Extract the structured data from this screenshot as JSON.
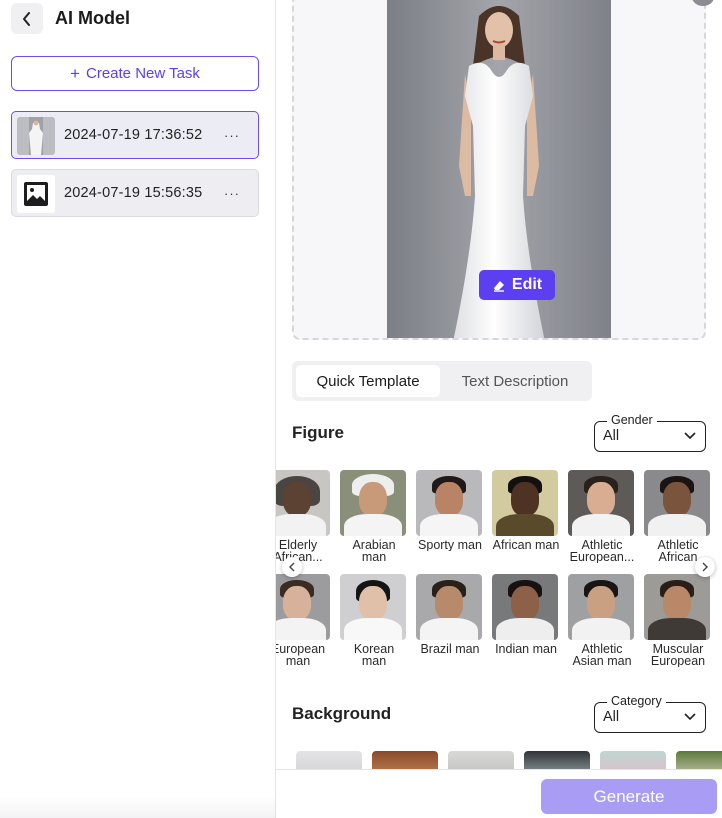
{
  "header": {
    "title": "AI Model"
  },
  "sidebar": {
    "create_label": "Create New Task",
    "tasks": [
      {
        "timestamp": "2024-07-19 17:36:52",
        "more": "···"
      },
      {
        "timestamp": "2024-07-19 15:56:35",
        "more": "···"
      }
    ]
  },
  "preview": {
    "edit_label": "Edit"
  },
  "mode_tabs": [
    "Quick Template",
    "Text Description"
  ],
  "figure": {
    "title": "Figure",
    "gender_legend": "Gender",
    "gender_value": "All",
    "row1": [
      {
        "label": "Elderly African..."
      },
      {
        "label": "Arabian man"
      },
      {
        "label": "Sporty man"
      },
      {
        "label": "African man"
      },
      {
        "label": "Athletic European..."
      },
      {
        "label": "Athletic African"
      }
    ],
    "row2": [
      {
        "label": "European man"
      },
      {
        "label": "Korean man"
      },
      {
        "label": "Brazil man"
      },
      {
        "label": "Indian man"
      },
      {
        "label": "Athletic Asian man"
      },
      {
        "label": "Muscular European"
      }
    ]
  },
  "background": {
    "title": "Background",
    "category_legend": "Category",
    "category_value": "All"
  },
  "footer": {
    "generate_label": "Generate"
  },
  "colors": {
    "accent": "#5b3ff0",
    "generate_disabled": "#a89cf4"
  }
}
